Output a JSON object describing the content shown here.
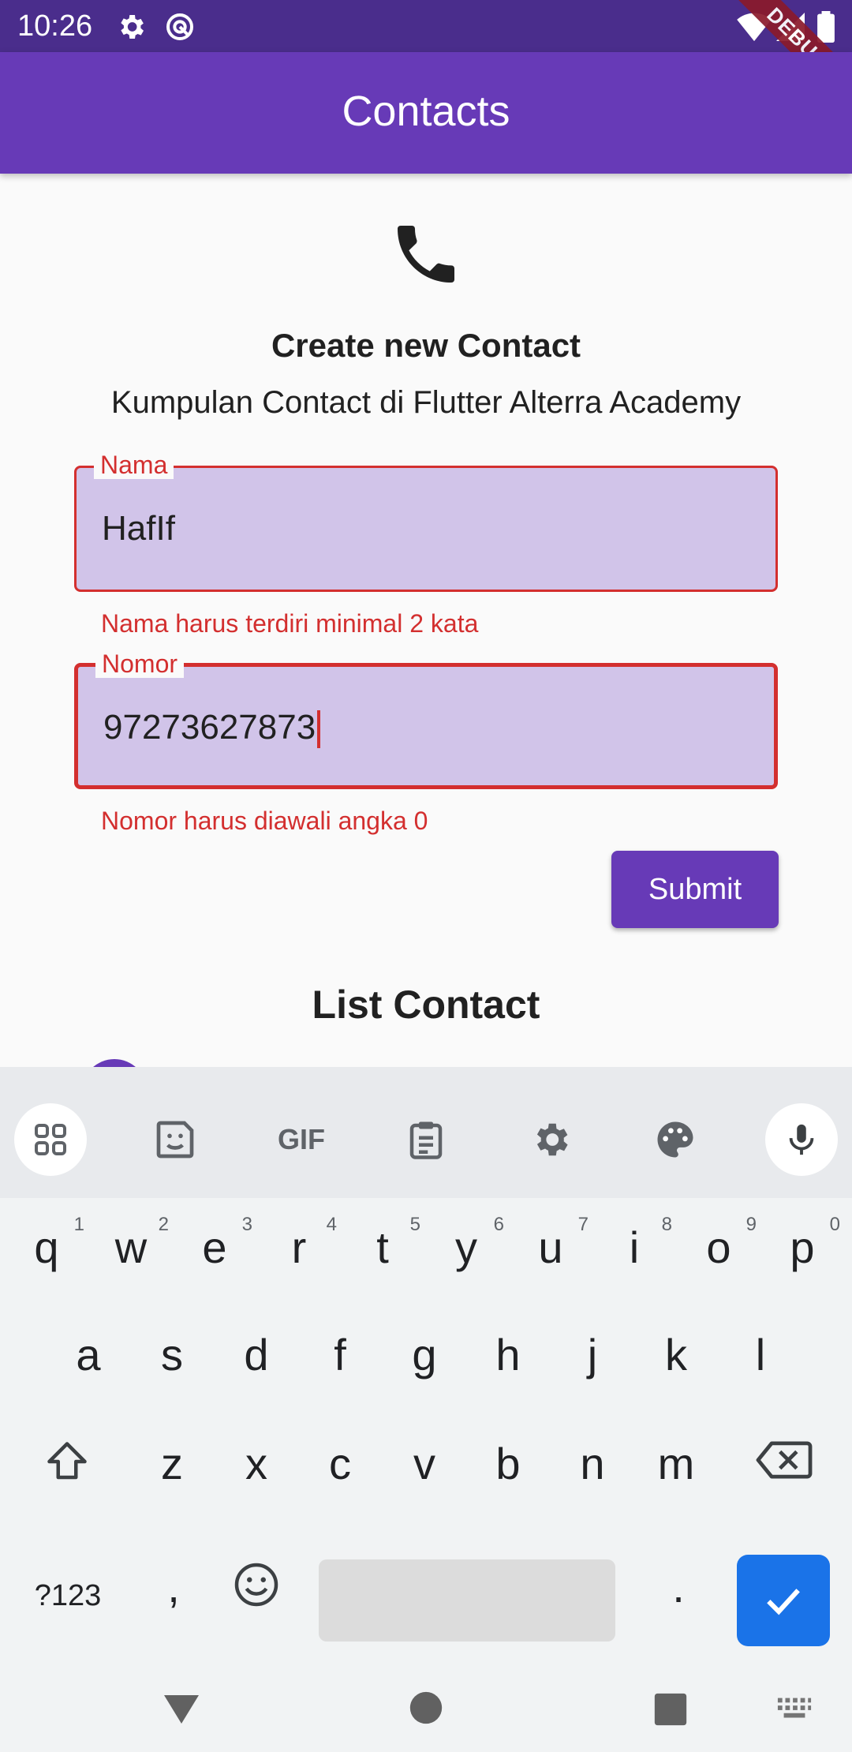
{
  "status_bar": {
    "time": "10:26",
    "debug_label": "DEBUG"
  },
  "app_bar": {
    "title": "Contacts"
  },
  "form": {
    "heading": "Create new Contact",
    "subheading": "Kumpulan Contact di Flutter Alterra Academy",
    "name_field": {
      "label": "Nama",
      "value": "HafIf",
      "error": "Nama harus terdiri minimal 2 kata"
    },
    "number_field": {
      "label": "Nomor",
      "value": "97273627873",
      "error": "Nomor harus diawali angka 0"
    },
    "submit_label": "Submit"
  },
  "list": {
    "heading": "List Contact"
  },
  "keyboard": {
    "toolbar_icons": [
      "apps-grid-icon",
      "sticker-icon",
      "gif-icon",
      "clipboard-icon",
      "settings-icon",
      "palette-icon",
      "mic-icon"
    ],
    "gif_label": "GIF",
    "row1": [
      [
        "q",
        "1"
      ],
      [
        "w",
        "2"
      ],
      [
        "e",
        "3"
      ],
      [
        "r",
        "4"
      ],
      [
        "t",
        "5"
      ],
      [
        "y",
        "6"
      ],
      [
        "u",
        "7"
      ],
      [
        "i",
        "8"
      ],
      [
        "o",
        "9"
      ],
      [
        "p",
        "0"
      ]
    ],
    "row2": [
      "a",
      "s",
      "d",
      "f",
      "g",
      "h",
      "j",
      "k",
      "l"
    ],
    "row3": [
      "z",
      "x",
      "c",
      "v",
      "b",
      "n",
      "m"
    ],
    "symbols_label": "?123",
    "comma": ",",
    "period": "."
  },
  "colors": {
    "primary": "#673ab7",
    "status_bar": "#4a2d8c",
    "error": "#d32f2f",
    "field_fill": "#d1c4e9",
    "enter_key": "#1a73e8"
  }
}
